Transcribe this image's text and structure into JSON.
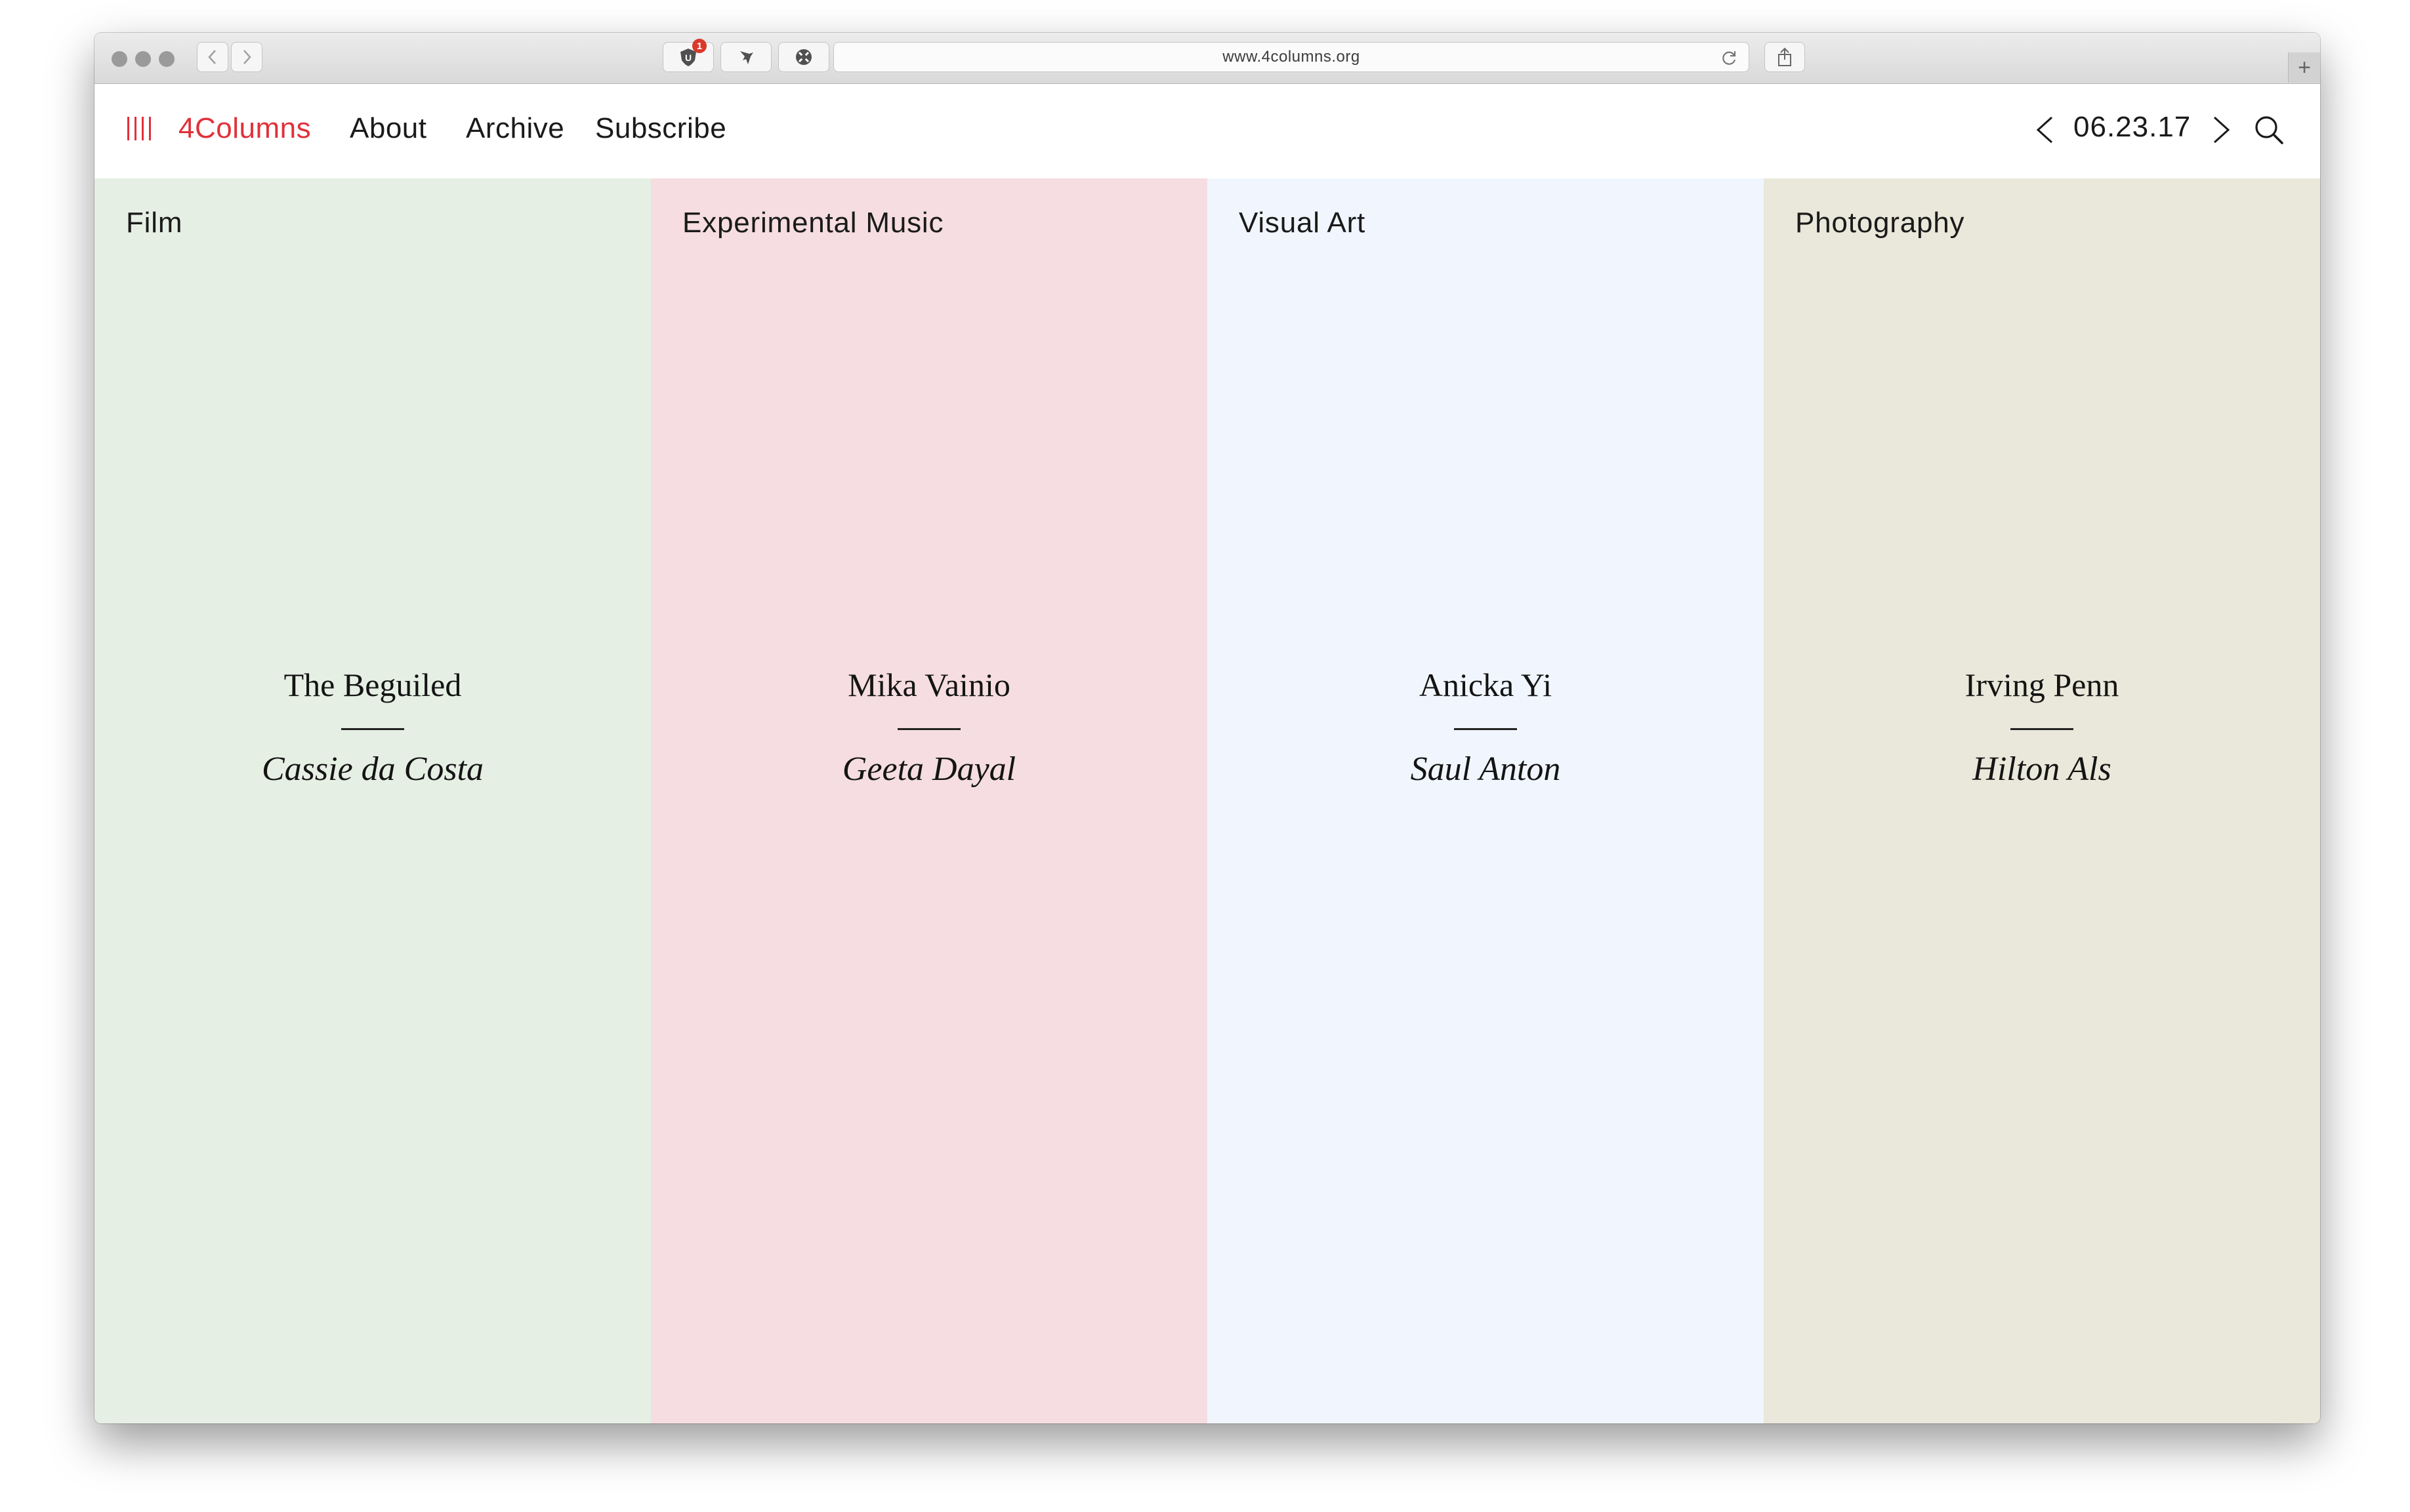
{
  "browser": {
    "url": "www.4columns.org",
    "extension_badge": "1",
    "new_tab_glyph": "+",
    "icons": [
      "back-icon",
      "forward-icon",
      "ublock-icon",
      "bird-icon",
      "settings-icon",
      "reload-icon",
      "share-icon",
      "plus-icon"
    ]
  },
  "header": {
    "logo": "4Columns",
    "nav": [
      "About",
      "Archive",
      "Subscribe"
    ],
    "date": "06.23.17",
    "logo_color": "#e0313a"
  },
  "columns": [
    {
      "category": "Film",
      "title": "The Beguiled",
      "author": "Cassie da Costa",
      "bg": "#e6efe3"
    },
    {
      "category": "Experimental Music",
      "title": "Mika Vainio",
      "author": "Geeta Dayal",
      "bg": "#f5dde1"
    },
    {
      "category": "Visual Art",
      "title": "Anicka Yi",
      "author": "Saul Anton",
      "bg": "#f1f6fe"
    },
    {
      "category": "Photography",
      "title": "Irving Penn",
      "author": "Hilton Als",
      "bg": "#e9e8da"
    }
  ]
}
